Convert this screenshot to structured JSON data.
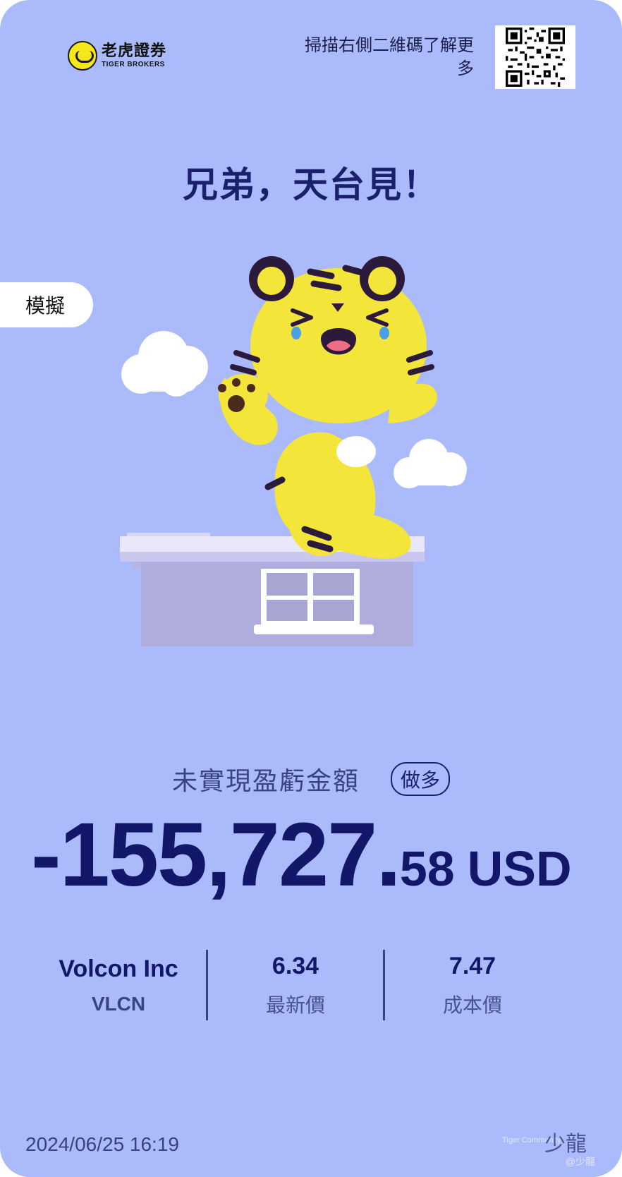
{
  "brand": {
    "name_cn": "老虎證券",
    "name_en": "TIGER BROKERS"
  },
  "header": {
    "scan_text": "掃描右側二維碼了解更多"
  },
  "headline": "兄弟，天台見！",
  "mode_tag": "模擬",
  "pnl": {
    "label": "未實現盈虧金額",
    "direction": "做多",
    "amount_main": "-155,727.",
    "amount_decimal": "58",
    "currency": "USD"
  },
  "stats": {
    "company": "Volcon Inc",
    "ticker": "VLCN",
    "latest_price": "6.34",
    "latest_price_label": "最新價",
    "cost_price": "7.47",
    "cost_price_label": "成本價"
  },
  "timestamp": "2024/06/25 16:19",
  "watermark": {
    "community": "Tiger Community",
    "name": "少龍",
    "handle": "@少龍"
  },
  "colors": {
    "background": "#aabafa",
    "primary_text": "#12176a",
    "tiger": "#f6e71a"
  }
}
